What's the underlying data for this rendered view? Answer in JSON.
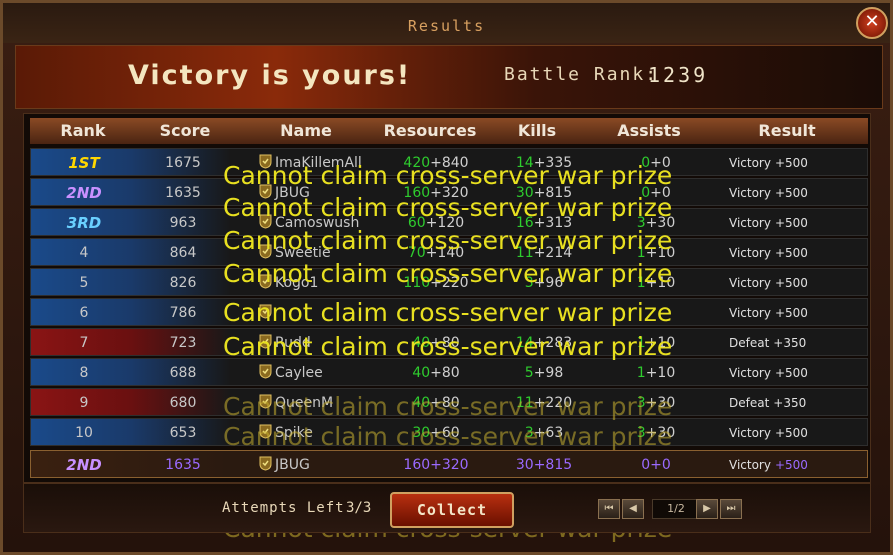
{
  "window": {
    "title": "Results"
  },
  "banner": {
    "victory_text": "Victory is yours!",
    "battle_rank_label": "Battle Rank:",
    "battle_rank_value": "1239"
  },
  "table": {
    "headers": [
      "Rank",
      "Score",
      "Name",
      "Resources",
      "Kills",
      "Assists",
      "Result"
    ],
    "rows": [
      {
        "rank": "1ST",
        "score": "1675",
        "name": "ImaKillemAll",
        "res_base": "420",
        "res_bonus": "+840",
        "kills_base": "14",
        "kills_bonus": "+335",
        "assists_base": "0",
        "assists_bonus": "+0",
        "result": "Victory",
        "reward": "+500"
      },
      {
        "rank": "2ND",
        "score": "1635",
        "name": "JBUG",
        "res_base": "160",
        "res_bonus": "+320",
        "kills_base": "30",
        "kills_bonus": "+815",
        "assists_base": "0",
        "assists_bonus": "+0",
        "result": "Victory",
        "reward": "+500"
      },
      {
        "rank": "3RD",
        "score": "963",
        "name": "Camoswush",
        "res_base": "60",
        "res_bonus": "+120",
        "kills_base": "16",
        "kills_bonus": "+313",
        "assists_base": "3",
        "assists_bonus": "+30",
        "result": "Victory",
        "reward": "+500"
      },
      {
        "rank": "4",
        "score": "864",
        "name": "Sweetie",
        "res_base": "70",
        "res_bonus": "+140",
        "kills_base": "11",
        "kills_bonus": "+214",
        "assists_base": "1",
        "assists_bonus": "+10",
        "result": "Victory",
        "reward": "+500"
      },
      {
        "rank": "5",
        "score": "826",
        "name": "Kogo1",
        "res_base": "110",
        "res_bonus": "+220",
        "kills_base": "3",
        "kills_bonus": "+96",
        "assists_base": "1",
        "assists_bonus": "+10",
        "result": "Victory",
        "reward": "+500"
      },
      {
        "rank": "6",
        "score": "786",
        "name": "",
        "res_base": "",
        "res_bonus": "",
        "kills_base": "",
        "kills_bonus": "",
        "assists_base": "",
        "assists_bonus": "",
        "result": "Victory",
        "reward": "+500"
      },
      {
        "rank": "7",
        "score": "723",
        "name": "Rudd",
        "res_base": "40",
        "res_bonus": "+80",
        "kills_base": "14",
        "kills_bonus": "+283",
        "assists_base": "1",
        "assists_bonus": "+10",
        "result": "Defeat",
        "reward": "+350"
      },
      {
        "rank": "8",
        "score": "688",
        "name": "Caylee",
        "res_base": "40",
        "res_bonus": "+80",
        "kills_base": "5",
        "kills_bonus": "+98",
        "assists_base": "1",
        "assists_bonus": "+10",
        "result": "Victory",
        "reward": "+500"
      },
      {
        "rank": "9",
        "score": "680",
        "name": "QueenM",
        "res_base": "40",
        "res_bonus": "+80",
        "kills_base": "11",
        "kills_bonus": "+220",
        "assists_base": "3",
        "assists_bonus": "+30",
        "result": "Defeat",
        "reward": "+350"
      },
      {
        "rank": "10",
        "score": "653",
        "name": "Spike",
        "res_base": "30",
        "res_bonus": "+60",
        "kills_base": "3",
        "kills_bonus": "+63",
        "assists_base": "3",
        "assists_bonus": "+30",
        "result": "Victory",
        "reward": "+500"
      }
    ],
    "self_row": {
      "rank": "2ND",
      "score": "1635",
      "name": "JBUG",
      "res_base": "160",
      "res_bonus": "+320",
      "kills_base": "30",
      "kills_bonus": "+815",
      "assists_base": "0",
      "assists_bonus": "+0",
      "result": "Victory",
      "reward": "+500"
    }
  },
  "overlay_message": "Cannot claim cross-server war prize",
  "footer": {
    "attempts_label": "Attempts Left",
    "attempts_value": "3/3",
    "collect_label": "Collect",
    "page_indicator": "1/2"
  },
  "colors": {
    "accent_gold": "#d0a060",
    "green": "#2ecc2e",
    "self_purple": "#9a6aff"
  }
}
